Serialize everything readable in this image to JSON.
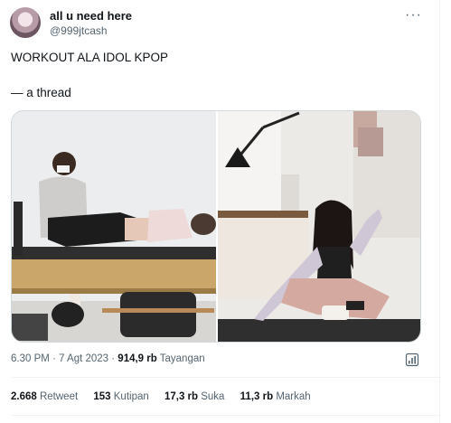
{
  "author": {
    "name": "all u need here",
    "handle": "@999jtcash"
  },
  "tweet": {
    "line1": "WORKOUT ALA IDOL KPOP",
    "line2": "— a thread"
  },
  "meta": {
    "time": "6.30 PM",
    "sep1": " · ",
    "date": "7 Agt 2023",
    "sep2": " · ",
    "views": "914,9 rb",
    "views_label": " Tayangan"
  },
  "stats": [
    {
      "num": "2.668",
      "label": " Retweet"
    },
    {
      "num": "153",
      "label": " Kutipan"
    },
    {
      "num": "17,3 rb",
      "label": " Suka"
    },
    {
      "num": "11,3 rb",
      "label": " Markah"
    }
  ],
  "icons": {
    "more": "more-icon",
    "analytics": "analytics-icon"
  }
}
